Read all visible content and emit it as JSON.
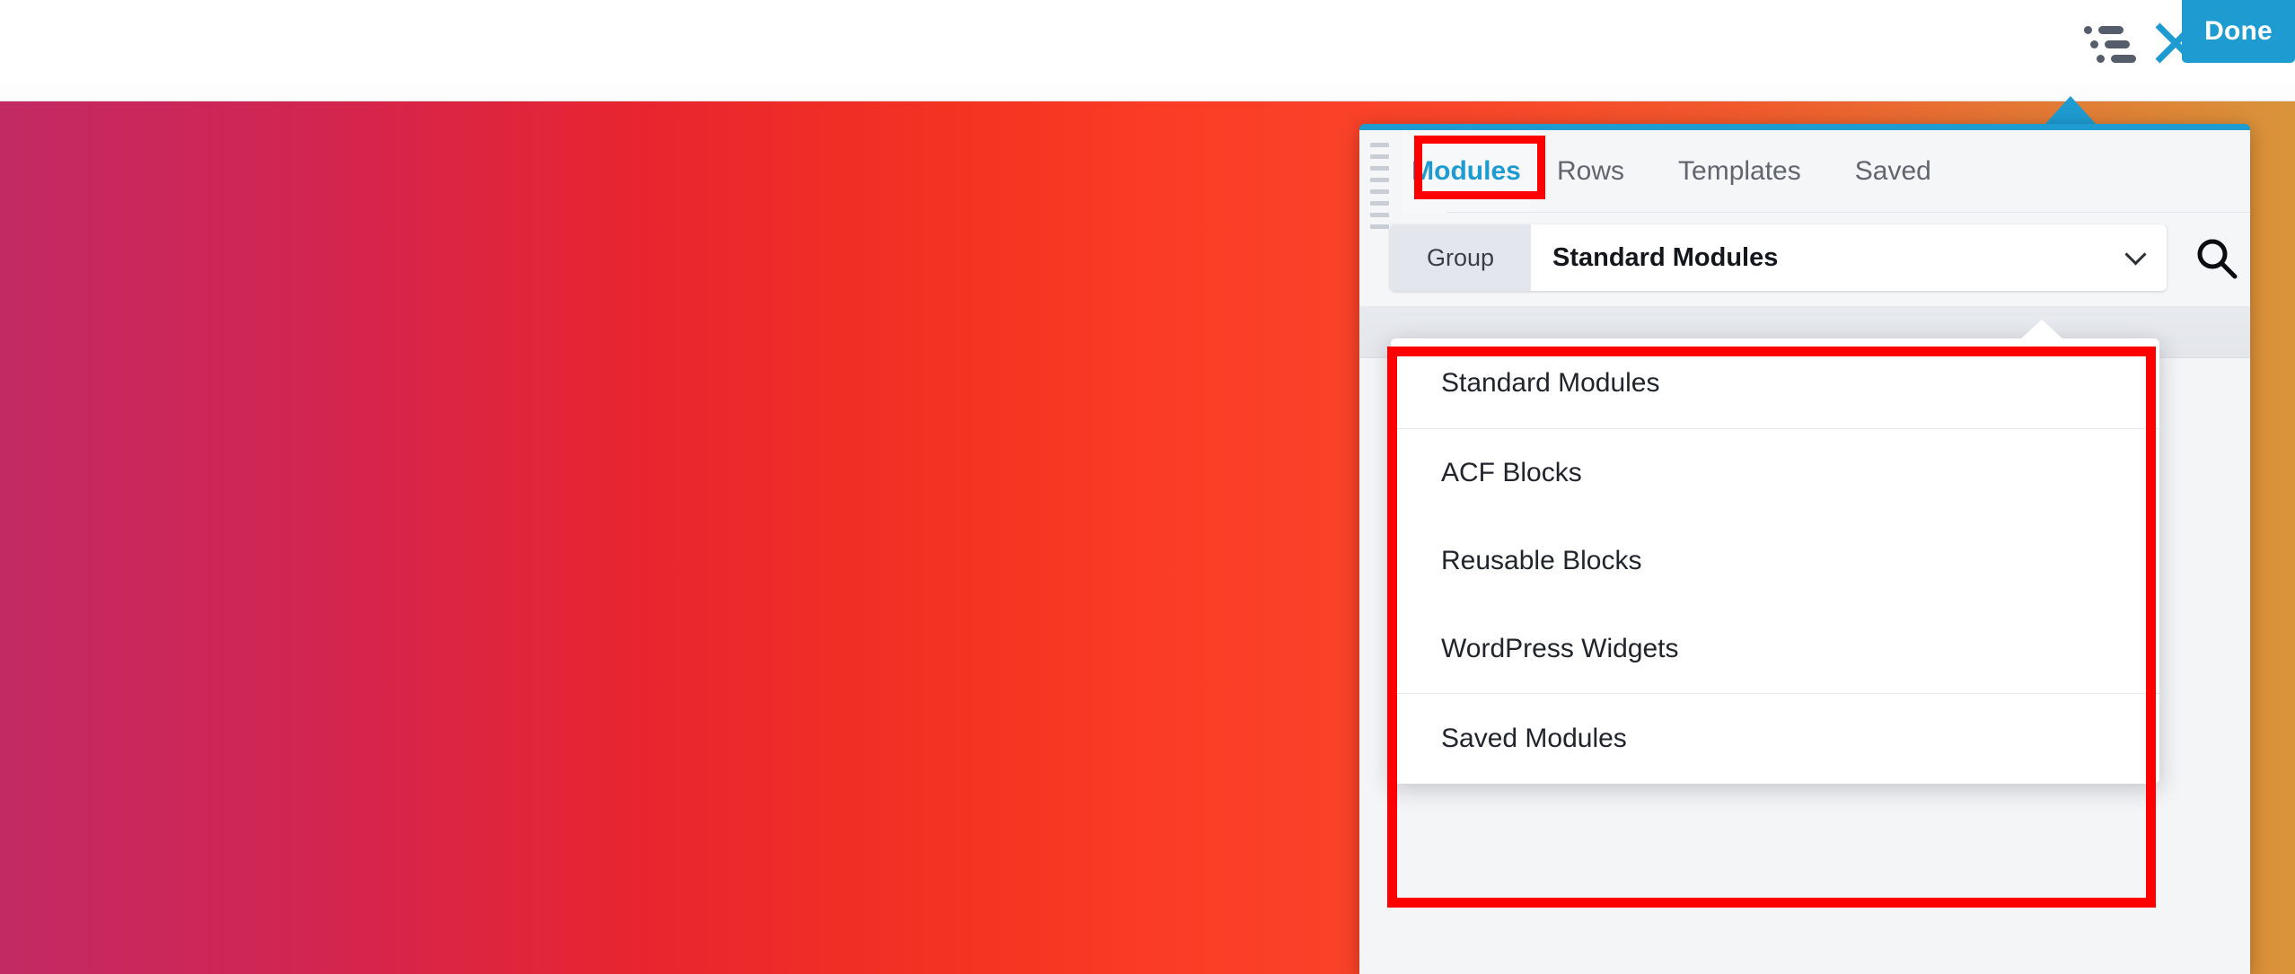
{
  "topbar": {
    "outline_icon": "outline-list-icon",
    "close_icon": "close-x-icon",
    "done_label": "Done"
  },
  "panel": {
    "drag_handle": "drag-handle",
    "tabs": [
      {
        "label": "Modules",
        "active": true
      },
      {
        "label": "Rows",
        "active": false
      },
      {
        "label": "Templates",
        "active": false
      },
      {
        "label": "Saved",
        "active": false
      }
    ],
    "group_label": "Group",
    "group_selected": "Standard Modules",
    "chevron_icon": "chevron-down-icon",
    "search_icon": "search-icon"
  },
  "dropdown": {
    "groups": [
      {
        "items": [
          "Standard Modules"
        ]
      },
      {
        "items": [
          "ACF Blocks",
          "Reusable Blocks",
          "WordPress Widgets"
        ]
      },
      {
        "items": [
          "Saved Modules"
        ]
      }
    ]
  },
  "annotations": {
    "modules_tab_highlight": "red-rectangle",
    "dropdown_highlight": "red-rectangle",
    "color": "#fe0000"
  },
  "theme": {
    "accent": "#1e9cd1",
    "gradient_start": "#c22a64",
    "gradient_mid": "#fb3d26",
    "gradient_end": "#d9943a"
  }
}
